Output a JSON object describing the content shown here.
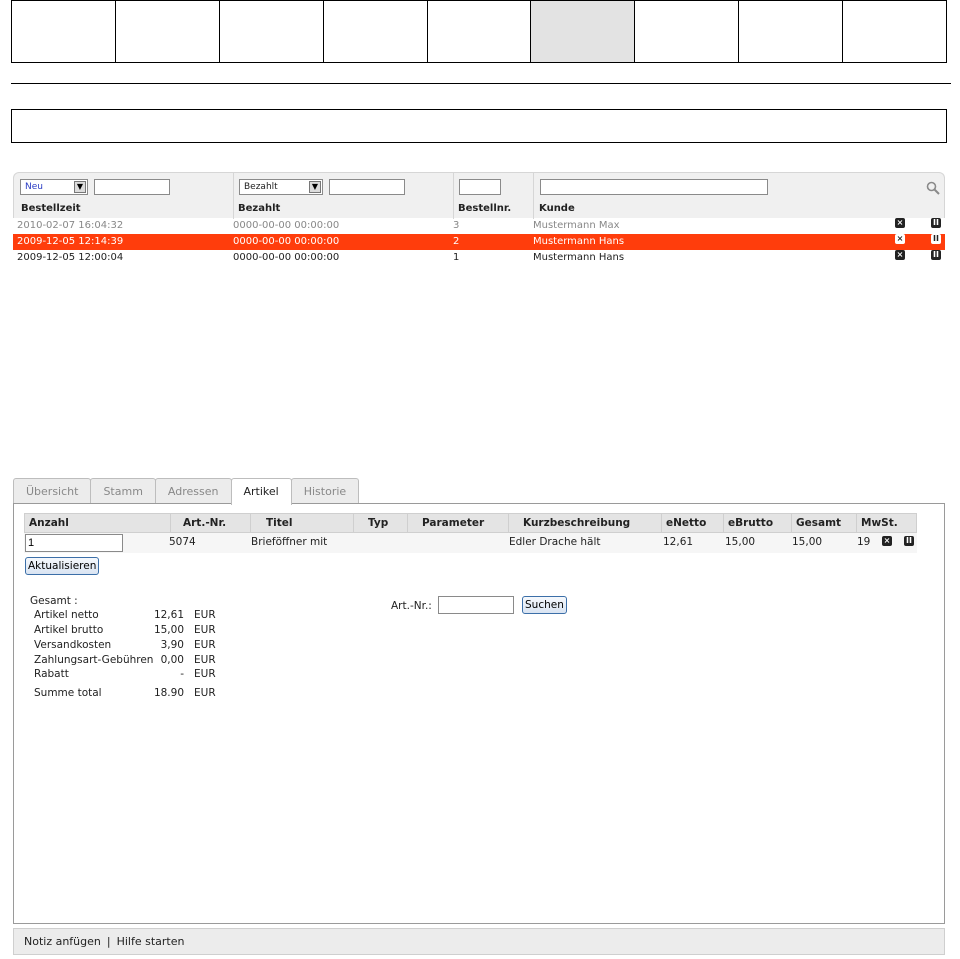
{
  "nav": {
    "cells": 9,
    "active_index": 5
  },
  "orders": {
    "filters": {
      "status_select": "Neu",
      "status_input": "",
      "paid_select": "Bezahlt",
      "paid_input": "",
      "order_no_input": "",
      "customer_input": ""
    },
    "headers": {
      "time": "Bestellzeit",
      "paid": "Bezahlt",
      "order_no": "Bestellnr.",
      "customer": "Kunde"
    },
    "rows": [
      {
        "time": "2010-02-07 16:04:32",
        "paid": "0000-00-00 00:00:00",
        "order_no": "3",
        "customer": "Mustermann Max",
        "state": "grey"
      },
      {
        "time": "2009-12-05 12:14:39",
        "paid": "0000-00-00 00:00:00",
        "order_no": "2",
        "customer": "Mustermann Hans",
        "state": "selected"
      },
      {
        "time": "2009-12-05 12:00:04",
        "paid": "0000-00-00 00:00:00",
        "order_no": "1",
        "customer": "Mustermann Hans",
        "state": "normal"
      }
    ],
    "icons": {
      "delete": "close-icon",
      "pause": "pause-icon",
      "search": "search-icon"
    },
    "selected_color": "#ff3d0c"
  },
  "tabs": [
    {
      "label": "Übersicht",
      "active": false
    },
    {
      "label": "Stamm",
      "active": false
    },
    {
      "label": "Adressen",
      "active": false
    },
    {
      "label": "Artikel",
      "active": true
    },
    {
      "label": "Historie",
      "active": false
    }
  ],
  "articles": {
    "headers": {
      "qty": "Anzahl",
      "artno": "Art.-Nr.",
      "title": "Titel",
      "type": "Typ",
      "param": "Parameter",
      "desc": "Kurzbeschreibung",
      "net": "eNetto",
      "gross": "eBrutto",
      "total": "Gesamt",
      "vat": "MwSt."
    },
    "rows": [
      {
        "qty": "1",
        "artno": "5074",
        "title": "Brieföffner mit",
        "type": "",
        "param": "",
        "desc": "Edler Drache hält",
        "net": "12,61",
        "gross": "15,00",
        "total": "15,00",
        "vat": "19"
      }
    ],
    "update_button": "Aktualisieren",
    "totals": {
      "title": "Gesamt :",
      "lines": [
        {
          "label": "Artikel netto",
          "value": "12,61",
          "cur": "EUR"
        },
        {
          "label": "Artikel brutto",
          "value": "15,00",
          "cur": "EUR"
        },
        {
          "label": "Versandkosten",
          "value": "3,90",
          "cur": "EUR"
        },
        {
          "label": "Zahlungsart-Gebühren",
          "value": "0,00",
          "cur": "EUR"
        },
        {
          "label": "Rabatt",
          "value": "-",
          "cur": "EUR"
        },
        {
          "label": "Summe total",
          "value": "18.90",
          "cur": "EUR"
        }
      ]
    },
    "search": {
      "label": "Art.-Nr.:",
      "value": "",
      "button": "Suchen"
    }
  },
  "footer": {
    "note": "Notiz anfügen",
    "separator": "|",
    "help": "Hilfe starten"
  }
}
